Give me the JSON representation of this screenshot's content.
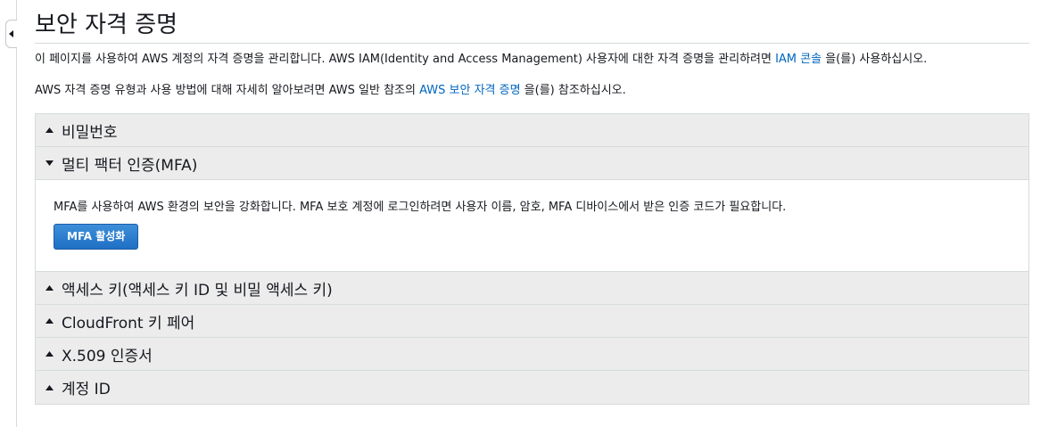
{
  "page": {
    "title": "보안 자격 증명"
  },
  "intro": {
    "line1_text": "이 페이지를 사용하여 AWS 계정의 자격 증명을 관리합니다. AWS IAM(Identity and Access Management) 사용자에 대한 자격 증명을 관리하려면 ",
    "line1_link": "IAM 콘솔",
    "line1_suffix": " 을(를) 사용하십시오.",
    "line2_text": "AWS 자격 증명 유형과 사용 방법에 대해 자세히 알아보려면 AWS 일반 참조의 ",
    "line2_link": "AWS 보안 자격 증명",
    "line2_suffix": " 을(를) 참조하십시오."
  },
  "sections": {
    "password": {
      "label": "비밀번호",
      "expanded": false
    },
    "mfa": {
      "label": "멀티 팩터 인증(MFA)",
      "expanded": true,
      "description": "MFA를 사용하여 AWS 환경의 보안을 강화합니다. MFA 보호 계정에 로그인하려면 사용자 이름, 암호, MFA 디바이스에서 받은 인증 코드가 필요합니다.",
      "button_label": "MFA 활성화"
    },
    "access_keys": {
      "label": "액세스 키(액세스 키 ID 및 비밀 액세스 키)",
      "expanded": false
    },
    "cloudfront": {
      "label": "CloudFront 키 페어",
      "expanded": false
    },
    "x509": {
      "label": "X.509 인증서",
      "expanded": false
    },
    "account_id": {
      "label": "계정 ID",
      "expanded": false
    }
  },
  "icons": {
    "collapse": "caret-left-icon",
    "collapsed_section": "caret-up-icon",
    "expanded_section": "caret-down-icon"
  },
  "colors": {
    "link": "#0066c0",
    "primary_button": "#1f6fc5",
    "header_bg": "#ececec",
    "border": "#d5dbdb"
  }
}
